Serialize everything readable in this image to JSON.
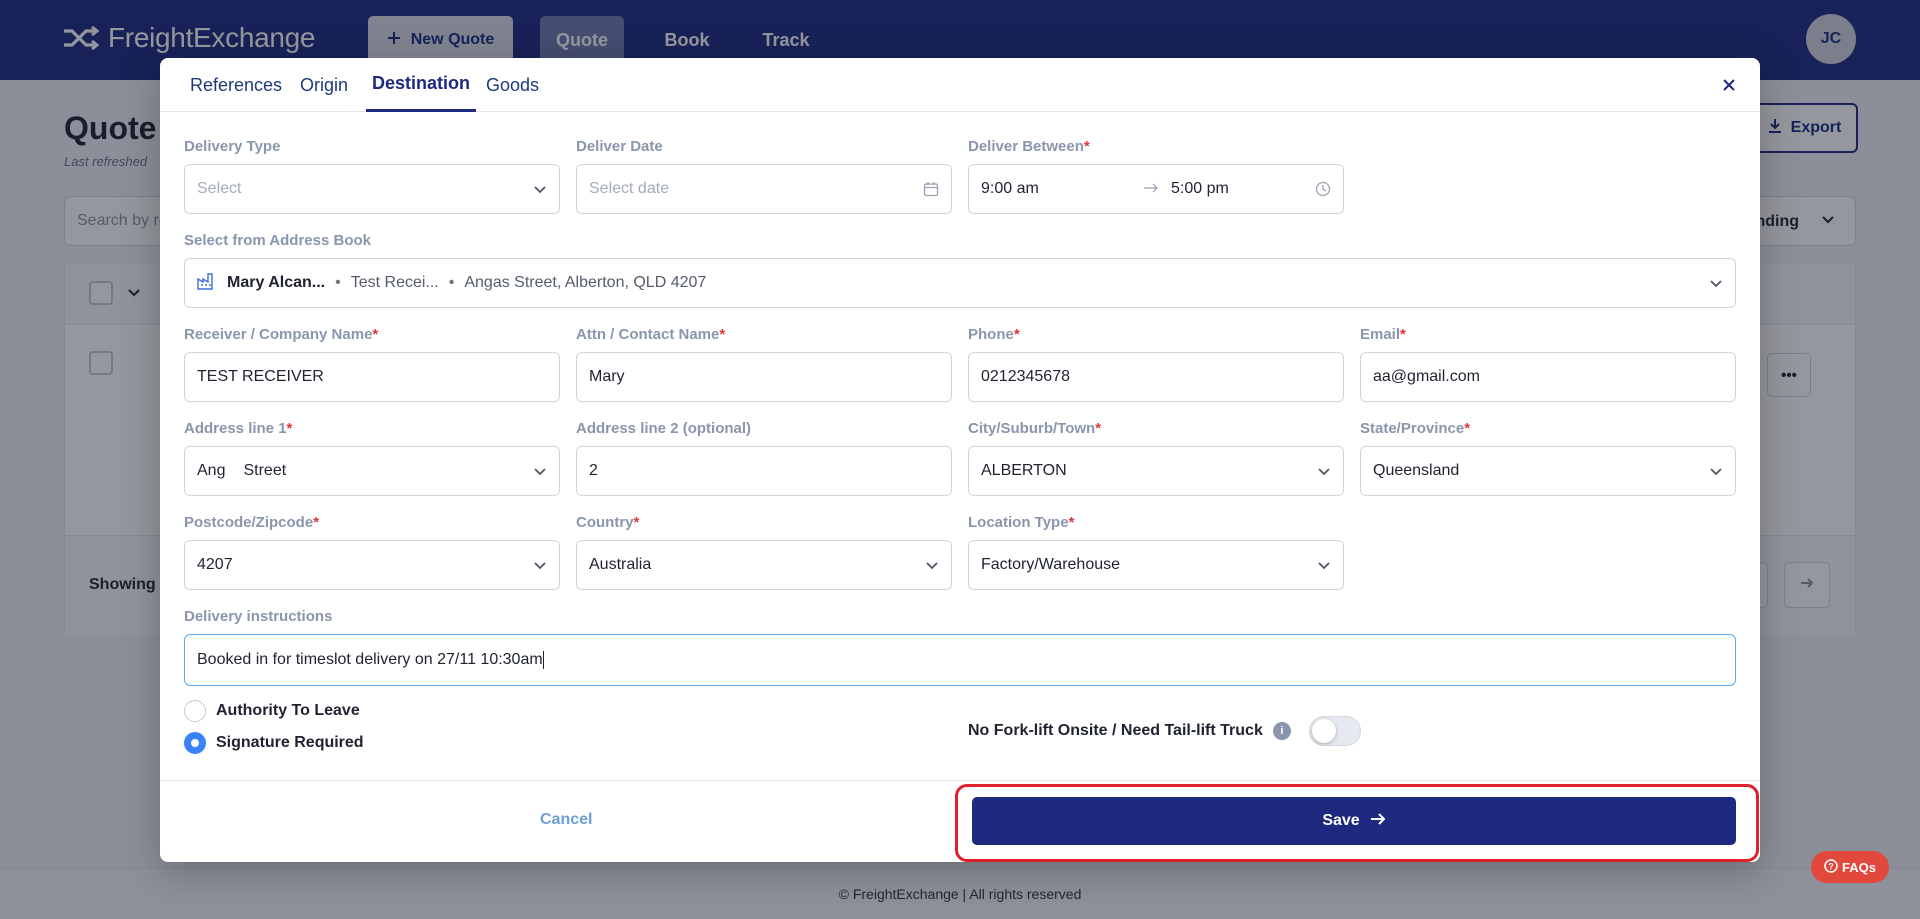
{
  "topnav": {
    "logo_text": "FreightExchange",
    "new_quote_label": "New Quote",
    "tabs": [
      "Quote",
      "Book",
      "Track"
    ],
    "avatar_initials": "JC"
  },
  "background": {
    "title": "Quote",
    "refreshed": "Last refreshed",
    "export_label": "Export",
    "search_placeholder": "Search by re",
    "sort_label": "ending",
    "showing_label": "Showing",
    "footer": "© FreightExchange | All rights reserved"
  },
  "faq_label": "FAQs",
  "modal": {
    "tabs": [
      "References",
      "Origin",
      "Destination",
      "Goods"
    ],
    "active_tab": "Destination",
    "delivery_type": {
      "label": "Delivery Type",
      "placeholder": "Select"
    },
    "deliver_date": {
      "label": "Deliver Date",
      "placeholder": "Select date"
    },
    "deliver_between": {
      "label": "Deliver Between",
      "from": "9:00 am",
      "to": "5:00 pm"
    },
    "address_book": {
      "label": "Select from Address Book",
      "contact": "Mary Alcan...",
      "company": "Test Recei...",
      "address": "Angas Street, Alberton, QLD 4207"
    },
    "receiver": {
      "label": "Receiver / Company Name",
      "value": "TEST RECEIVER"
    },
    "attn": {
      "label": "Attn / Contact Name",
      "value": "Mary"
    },
    "phone": {
      "label": "Phone",
      "value": "0212345678"
    },
    "email": {
      "label": "Email",
      "value": "aa@gmail.com"
    },
    "address1": {
      "label": "Address line 1",
      "value_part1": "Ang",
      "value_part2": "Street"
    },
    "address2": {
      "label": "Address line 2 (optional)",
      "value": "2"
    },
    "city": {
      "label": "City/Suburb/Town",
      "value": "ALBERTON"
    },
    "state": {
      "label": "State/Province",
      "value": "Queensland"
    },
    "postcode": {
      "label": "Postcode/Zipcode",
      "value": "4207"
    },
    "country": {
      "label": "Country",
      "value": "Australia"
    },
    "location_type": {
      "label": "Location Type",
      "value": "Factory/Warehouse"
    },
    "instructions": {
      "label": "Delivery instructions",
      "value": "Booked in for timeslot delivery on 27/11 10:30am"
    },
    "radio_authority": "Authority To Leave",
    "radio_signature": "Signature Required",
    "forklift_label": "No Fork-lift Onsite / Need Tail-lift Truck",
    "info_glyph": "i",
    "cancel_label": "Cancel",
    "save_label": "Save"
  },
  "colors": {
    "brand": "#1d2a80",
    "required": "#e0343a",
    "highlight": "#e0202a",
    "faq": "#e2483c"
  },
  "icons": [
    "shuffle-logo-icon",
    "plus-icon",
    "download-icon",
    "chevron-down-icon",
    "calendar-icon",
    "clock-icon",
    "arrow-right-icon",
    "building-icon",
    "close-icon",
    "help-icon",
    "info-icon",
    "ellipsis-icon"
  ]
}
